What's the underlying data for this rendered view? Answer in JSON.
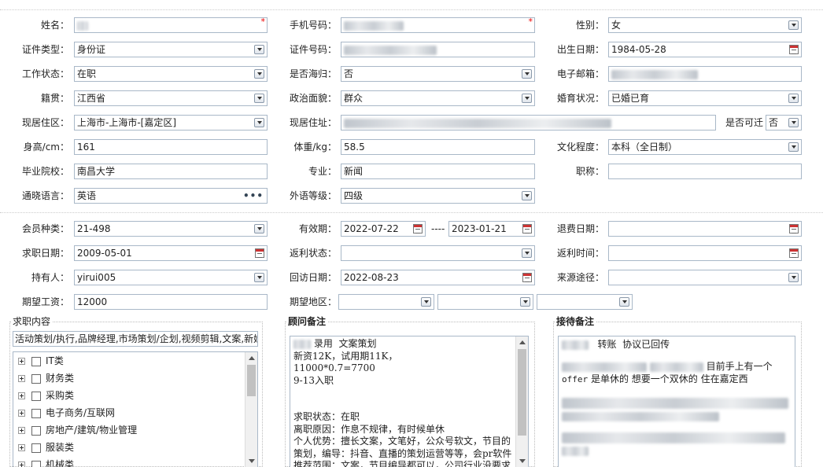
{
  "personal": {
    "name": {
      "label": "姓名：",
      "required_mark": "*"
    },
    "phone": {
      "label": "手机号码：",
      "required_mark": "*"
    },
    "gender": {
      "label": "性别：",
      "value": "女"
    },
    "id_type": {
      "label": "证件类型：",
      "value": "身份证"
    },
    "id_number": {
      "label": "证件号码："
    },
    "birth_date": {
      "label": "出生日期：",
      "value": "1984-05-28"
    },
    "work_status": {
      "label": "工作状态：",
      "value": "在职"
    },
    "overseas": {
      "label": "是否海归：",
      "value": "否"
    },
    "email": {
      "label": "电子邮箱："
    },
    "native_place": {
      "label": "籍贯：",
      "value": "江西省"
    },
    "political": {
      "label": "政治面貌：",
      "value": "群众"
    },
    "marital": {
      "label": "婚育状况：",
      "value": "已婚已育"
    },
    "residence_area": {
      "label": "现居住区：",
      "value": "上海市-上海市-[嘉定区]"
    },
    "address": {
      "label": "现居住址："
    },
    "relocate": {
      "label": "是否可迁",
      "value": "否"
    },
    "height": {
      "label": "身高/cm：",
      "value": "161"
    },
    "weight": {
      "label": "体重/kg：",
      "value": "58.5"
    },
    "education": {
      "label": "文化程度：",
      "value": "本科（全日制）"
    },
    "school": {
      "label": "毕业院校：",
      "value": "南昌大学"
    },
    "major": {
      "label": "专业：",
      "value": "新闻"
    },
    "title": {
      "label": "职称：",
      "value": ""
    },
    "language": {
      "label": "通晓语言：",
      "value": "英语",
      "more": "•••"
    },
    "lang_level": {
      "label": "外语等级：",
      "value": "四级"
    }
  },
  "membership": {
    "member_type": {
      "label": "会员种类：",
      "value": "21-498"
    },
    "validity": {
      "label": "有效期：",
      "start": "2022-07-22",
      "sep": "----",
      "end": "2023-01-21"
    },
    "refund_date": {
      "label": "退费日期：",
      "value": ""
    },
    "job_date": {
      "label": "求职日期：",
      "value": "2009-05-01"
    },
    "rebate_status": {
      "label": "返利状态：",
      "value": ""
    },
    "rebate_time": {
      "label": "返利时间：",
      "value": ""
    },
    "holder": {
      "label": "持有人：",
      "value": "yirui005"
    },
    "visit_date": {
      "label": "回访日期：",
      "value": "2022-08-23"
    },
    "source": {
      "label": "来源途径：",
      "value": ""
    },
    "salary": {
      "label": "期望工资：",
      "value": "12000"
    },
    "region": {
      "label": "期望地区：",
      "value": ""
    }
  },
  "job_content": {
    "title": "求职内容",
    "summary": "活动策划/执行,品牌经理,市场策划/企划,视频剪辑,文案,新媒",
    "categories": [
      "IT类",
      "财务类",
      "采购类",
      "电子商务/互联网",
      "房地产/建筑/物业管理",
      "服装类",
      "机械类"
    ]
  },
  "advisor_notes": {
    "title": "顾问备注",
    "lines": [
      " 录用  文案策划",
      "新资12K，试用期11K，",
      "11000*0.7=7700",
      "9-13入职",
      "",
      "",
      "求职状态：在职",
      "离职原因：作息不规律，有时候单休",
      "个人优势：擅长文案，文笔好，公众号软文，节目的",
      "策划，编导：抖音、直播的策划运营等等，会pr软件",
      "推荐范围：文案，节目编导都可以，公司行业没要求"
    ]
  },
  "reception_notes": {
    "title": "接待备注",
    "line1": "   转账  协议已回传",
    "line2": "目前手上有一个",
    "line3a": "offer",
    "line3b": "是单休的  想要一个双休的     住在嘉定西"
  },
  "colors": {
    "border": "#a9b8c8",
    "required": "#ee0000",
    "calendar_red": "#cc3333"
  }
}
